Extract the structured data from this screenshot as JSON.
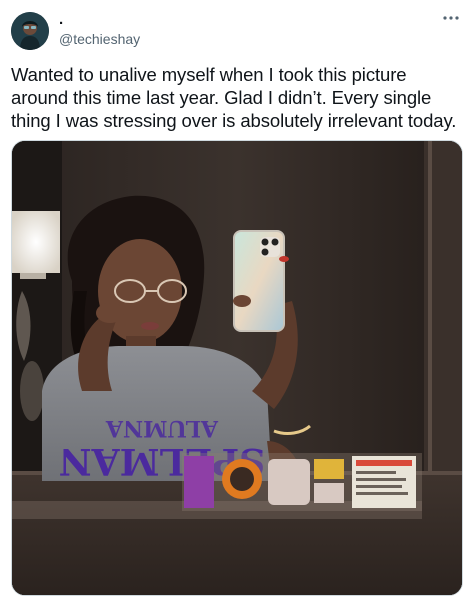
{
  "author": {
    "display_name": ".",
    "handle": "@techieshay",
    "avatar_icon": "user-avatar"
  },
  "tweet": {
    "text": "Wanted to unalive myself when I took this picture around this time last year. Glad I didn’t. Every single thing I was stressing over is absolutely irrelevant today."
  },
  "media": {
    "shirt_text_line1": "SPELMAN",
    "shirt_text_line2": "ALUMNA"
  },
  "colors": {
    "text_primary": "#0f1419",
    "text_secondary": "#536471",
    "border": "#cfd9de",
    "shirt_print": "#4b2a9e"
  }
}
